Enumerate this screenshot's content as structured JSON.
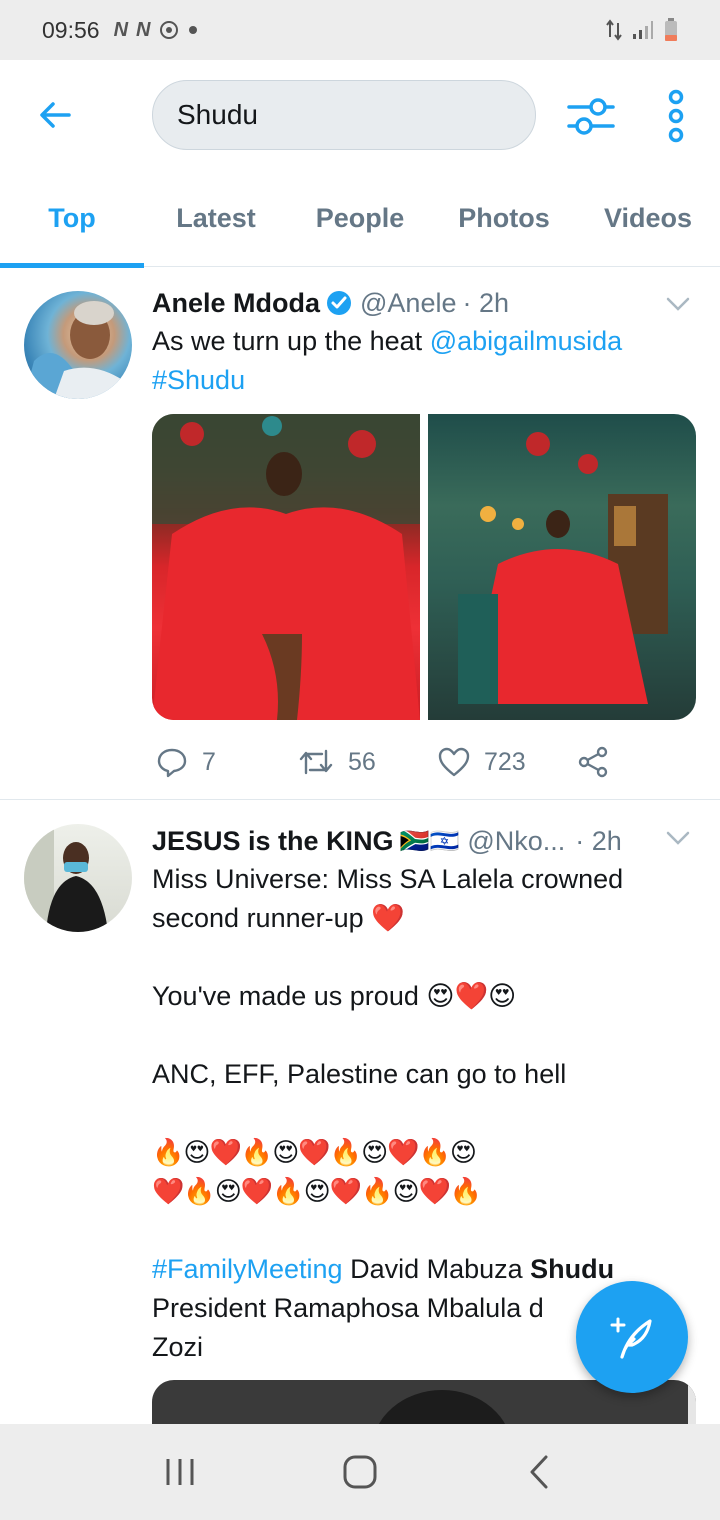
{
  "status_bar": {
    "time": "09:56",
    "icons": [
      "N",
      "N"
    ]
  },
  "search": {
    "query": "Shudu"
  },
  "tabs": [
    {
      "label": "Top"
    },
    {
      "label": "Latest"
    },
    {
      "label": "People"
    },
    {
      "label": "Photos"
    },
    {
      "label": "Videos"
    }
  ],
  "tweets": [
    {
      "author": "Anele Mdoda",
      "verified": true,
      "handle": "@Anele",
      "time": "· 2h",
      "text_plain": "As we turn up the heat ",
      "mention": "@abigailmusida",
      "hashtag": "#Shudu",
      "replies": "7",
      "retweets": "56",
      "likes": "723"
    },
    {
      "author": "JESUS is the KING",
      "flags": "🇿🇦🇮🇱",
      "handle": "@Nko...",
      "time": "· 2h",
      "line1": "Miss Universe: Miss SA Lalela crowned",
      "line2": "second runner-up ❤️",
      "line3": "You've made us proud 😍❤️😍",
      "line4": "ANC, EFF, Palestine can go to hell",
      "emoji_row1": "🔥😍❤️🔥😍❤️🔥😍❤️🔥😍",
      "emoji_row2": "❤️🔥😍❤️🔥😍❤️🔥😍❤️🔥",
      "hashtag": "#FamilyMeeting",
      "after_hashtag": " David Mabuza ",
      "bold_word": "Shudu",
      "line6": "President Ramaphosa Mbalula d",
      "line7": "Zozi"
    }
  ],
  "colors": {
    "accent": "#1da1f2",
    "muted": "#657786"
  }
}
